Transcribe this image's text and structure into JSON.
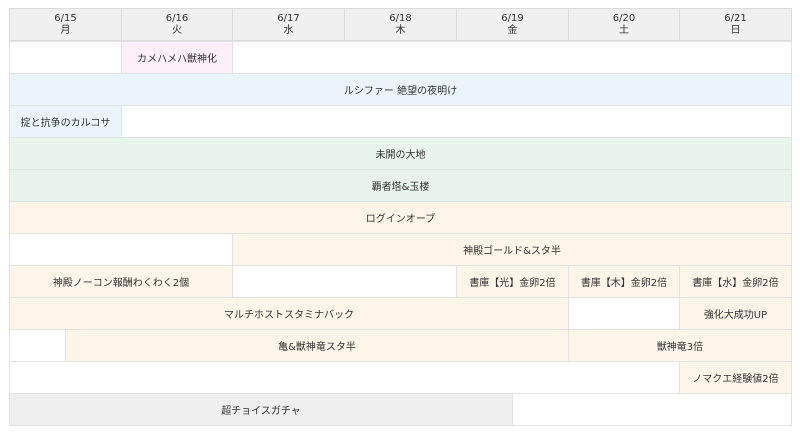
{
  "colors": {
    "blank": "#ffffff",
    "header": "#f0f0f0",
    "pink": "#fdf0fa",
    "blue": "#e9f5fb",
    "green": "#e8f5ec",
    "cream": "#fdf6e8",
    "gray": "#efefef"
  },
  "days": [
    {
      "date": "6/15",
      "dow": "月"
    },
    {
      "date": "6/16",
      "dow": "火"
    },
    {
      "date": "6/17",
      "dow": "水"
    },
    {
      "date": "6/18",
      "dow": "木"
    },
    {
      "date": "6/19",
      "dow": "金"
    },
    {
      "date": "6/20",
      "dow": "土"
    },
    {
      "date": "6/21",
      "dow": "日"
    }
  ],
  "rows": [
    [
      {
        "span": 1,
        "color": "blank",
        "label": ""
      },
      {
        "span": 1,
        "color": "pink",
        "label": "カメハメハ獣神化"
      },
      {
        "span": 5,
        "color": "blank",
        "label": ""
      }
    ],
    [
      {
        "span": 7,
        "color": "blue",
        "label": "ルシファー 絶望の夜明け"
      }
    ],
    [
      {
        "span": 1,
        "color": "blue",
        "label": "掟と抗争のカルコサ"
      },
      {
        "span": 6,
        "color": "blank",
        "label": ""
      }
    ],
    [
      {
        "span": 7,
        "color": "green",
        "label": "未開の大地"
      }
    ],
    [
      {
        "span": 7,
        "color": "green",
        "label": "覇者塔&玉楼"
      }
    ],
    [
      {
        "span": 7,
        "color": "cream",
        "label": "ログインオーブ"
      }
    ],
    [
      {
        "span": 2,
        "color": "blank",
        "label": ""
      },
      {
        "span": 5,
        "color": "cream",
        "label": "神殿ゴールド&スタ半"
      }
    ],
    [
      {
        "span": 2,
        "color": "cream",
        "label": "神殿ノーコン報酬わくわく2個"
      },
      {
        "span": 2,
        "color": "blank",
        "label": ""
      },
      {
        "span": 1,
        "color": "cream",
        "label": "書庫【光】金卵2倍"
      },
      {
        "span": 1,
        "color": "cream",
        "label": "書庫【木】金卵2倍"
      },
      {
        "span": 1,
        "color": "cream",
        "label": "書庫【水】金卵2倍"
      }
    ],
    [
      {
        "span": 5,
        "color": "cream",
        "label": "マルチホストスタミナバック"
      },
      {
        "span": 1,
        "color": "blank",
        "label": ""
      },
      {
        "span": 1,
        "color": "cream",
        "label": "強化大成功UP"
      }
    ],
    [
      {
        "span": 0.5,
        "color": "blank",
        "label": ""
      },
      {
        "span": 4.5,
        "color": "cream",
        "label": "亀&獣神竜スタ半"
      },
      {
        "span": 2,
        "color": "cream",
        "label": "獣神竜3倍"
      }
    ],
    [
      {
        "span": 6,
        "color": "blank",
        "label": ""
      },
      {
        "span": 1,
        "color": "cream",
        "label": "ノマクエ経験値2倍"
      }
    ],
    [
      {
        "span": 4.5,
        "color": "gray",
        "label": "超チョイスガチャ"
      },
      {
        "span": 2.5,
        "color": "blank",
        "label": ""
      }
    ]
  ]
}
